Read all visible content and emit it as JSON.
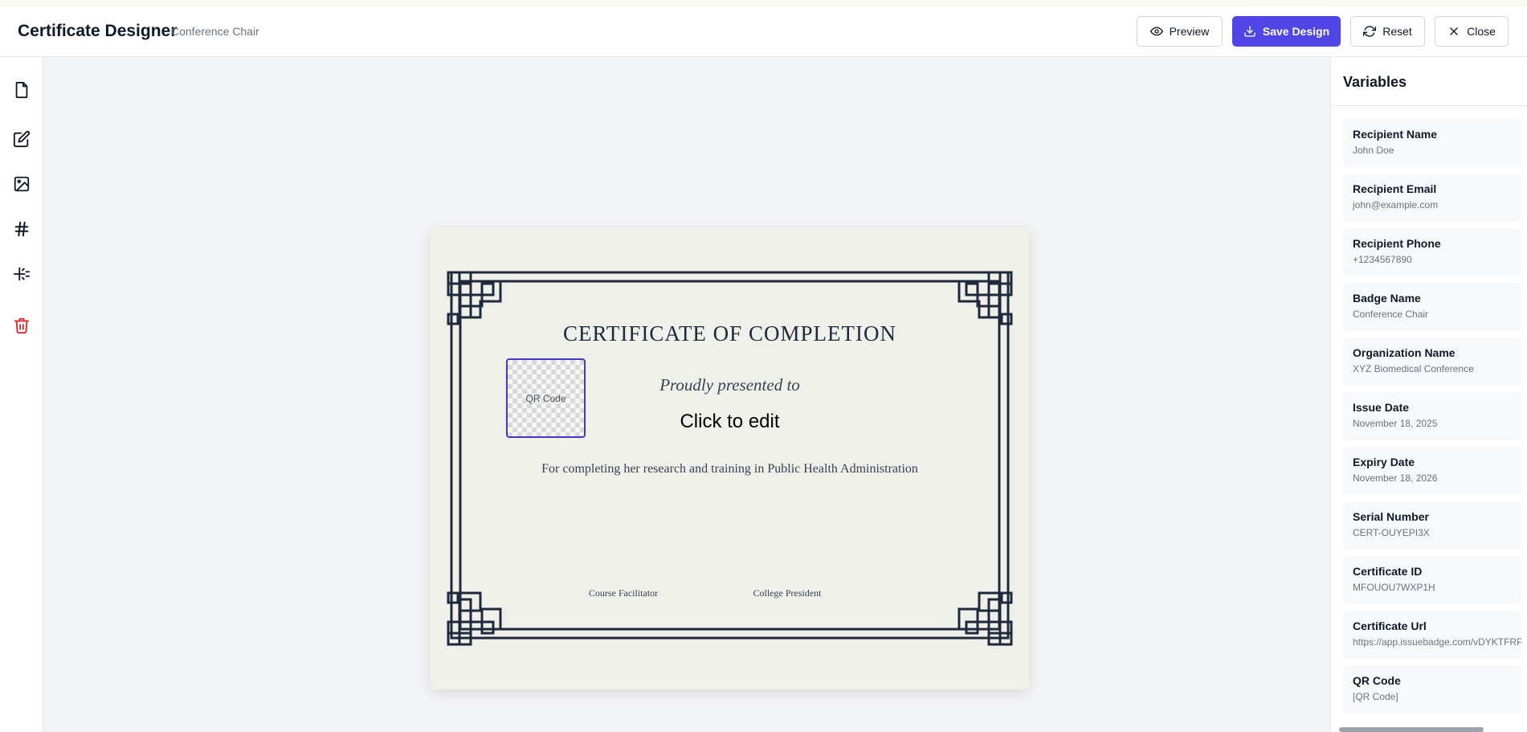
{
  "header": {
    "title": "Certificate Designer",
    "subtitle": "Conference Chair",
    "preview_label": "Preview",
    "save_label": "Save Design",
    "reset_label": "Reset",
    "close_label": "Close"
  },
  "toolbar": {
    "tools": [
      "page-icon",
      "edit-text-icon",
      "image-icon",
      "hash-icon",
      "sparkle-icon",
      "trash-icon"
    ]
  },
  "certificate": {
    "title": "CERTIFICATE OF COMPLETION",
    "qr_label": "QR Code",
    "presented": "Proudly presented to",
    "recipient_placeholder": "Click to edit",
    "reason": "For completing her research and training in Public Health Administration",
    "signature_left": "Course Facilitator",
    "signature_right": "College President",
    "border_color": "#1e2a3b"
  },
  "variables": {
    "title": "Variables",
    "items": [
      {
        "name": "Recipient Name",
        "value": "John Doe"
      },
      {
        "name": "Recipient Email",
        "value": "john@example.com"
      },
      {
        "name": "Recipient Phone",
        "value": "+1234567890"
      },
      {
        "name": "Badge Name",
        "value": "Conference Chair"
      },
      {
        "name": "Organization Name",
        "value": "XYZ Biomedical Conference"
      },
      {
        "name": "Issue Date",
        "value": "November 18, 2025"
      },
      {
        "name": "Expiry Date",
        "value": "November 18, 2026"
      },
      {
        "name": "Serial Number",
        "value": "CERT-OUYEPI3X"
      },
      {
        "name": "Certificate ID",
        "value": "MFOUOU7WXP1H"
      },
      {
        "name": "Certificate Url",
        "value": "https://app.issuebadge.com/vDYKTFRPDT"
      },
      {
        "name": "QR Code",
        "value": "[QR Code]"
      }
    ]
  },
  "colors": {
    "primary": "#4f46e5",
    "danger": "#dc2626",
    "canvas": "#f3f4f6",
    "paper": "#f0f0eb"
  }
}
